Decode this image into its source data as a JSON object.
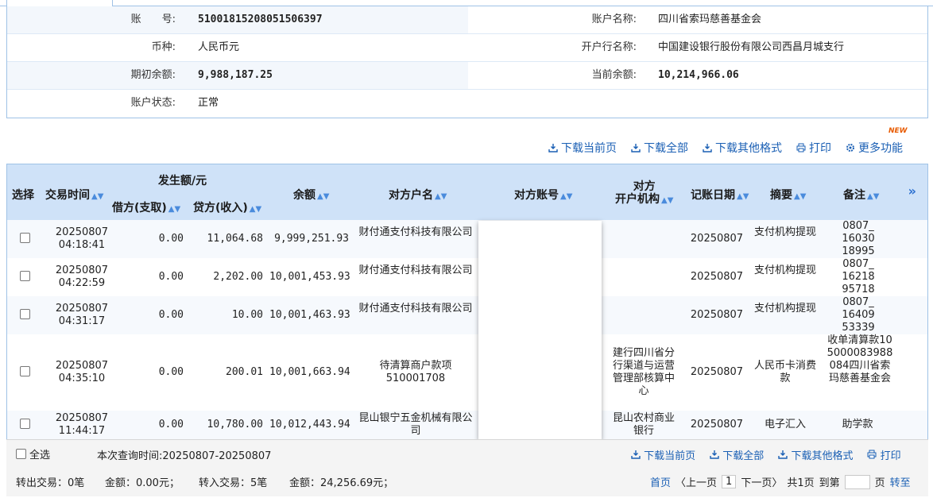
{
  "account": {
    "no_label": "账　　号:",
    "no_value": "51001815208051506397",
    "name_label": "账户名称:",
    "name_value": "四川省索玛慈善基金会",
    "currency_label": "币种:",
    "currency_value": "人民币元",
    "bank_label": "开户行名称:",
    "bank_value": "中国建设银行股份有限公司西昌月城支行",
    "opening_label": "期初余额:",
    "opening_value": "9,988,187.25",
    "current_label": "当前余额:",
    "current_value": "10,214,966.06",
    "status_label": "账户状态:",
    "status_value": "正常"
  },
  "toolbar": {
    "new_badge": "NEW",
    "items": [
      "下载当前页",
      "下载全部",
      "下载其他格式",
      "打印",
      "更多功能"
    ]
  },
  "table": {
    "headers": {
      "select": "选择",
      "time": "交易时间",
      "amount_group": "发生额/元",
      "debit": "借方(支取)",
      "credit": "贷方(收入)",
      "balance": "余额",
      "counter_name": "对方户名",
      "counter_acct": "对方账号",
      "counter_bank_1": "对方",
      "counter_bank_2": "开户机构",
      "book_date": "记账日期",
      "summary": "摘要",
      "remark": "备注",
      "expand": "»"
    },
    "rows": [
      {
        "date": "20250807",
        "time": "04:18:41",
        "debit": "0.00",
        "credit": "11,064.68",
        "balance": "9,999,251.93",
        "name": "财付通支付科技有限公司",
        "bank": "",
        "book": "20250807",
        "summary": "支付机构提现",
        "remark": "0807_1603018995"
      },
      {
        "date": "20250807",
        "time": "04:22:59",
        "debit": "0.00",
        "credit": "2,202.00",
        "balance": "10,001,453.93",
        "name": "财付通支付科技有限公司",
        "bank": "",
        "book": "20250807",
        "summary": "支付机构提现",
        "remark": "0807_1621895718"
      },
      {
        "date": "20250807",
        "time": "04:31:17",
        "debit": "0.00",
        "credit": "10.00",
        "balance": "10,001,463.93",
        "name": "财付通支付科技有限公司",
        "bank": "",
        "book": "20250807",
        "summary": "支付机构提现",
        "remark": "0807_1640953339"
      },
      {
        "date": "20250807",
        "time": "04:35:10",
        "debit": "0.00",
        "credit": "200.01",
        "balance": "10,001,663.94",
        "name": "待清算商户款项510001708",
        "bank": "建行四川省分行渠道与运营管理部核算中心",
        "book": "20250807",
        "summary": "人民币卡消费款",
        "remark": "收单清算款105000083988084四川省索玛慈善基金会"
      },
      {
        "date": "20250807",
        "time": "11:44:17",
        "debit": "0.00",
        "credit": "10,780.00",
        "balance": "10,012,443.94",
        "name": "昆山银宁五金机械有限公司",
        "bank": "昆山农村商业银行",
        "book": "20250807",
        "summary": "电子汇入",
        "remark": "助学款"
      }
    ]
  },
  "footer": {
    "select_all": "全选",
    "query_time": "本次查询时间:20250807-20250807",
    "actions": [
      "下载当前页",
      "下载全部",
      "下载其他格式",
      "打印"
    ],
    "out_label": "转出交易：0笔",
    "out_amount": "金额：0.00元；",
    "in_label": "转入交易：5笔",
    "in_amount": "金额：24,256.69元；",
    "first": "首页",
    "prev": "〈上一页",
    "page": "1",
    "next": "下一页〉",
    "total": "共1页",
    "goto_prefix": "到第",
    "goto_suffix": "页",
    "go": "转至"
  },
  "colors": {
    "accent": "#1a5fb4",
    "header_bg": "#cfe2f8",
    "border": "#9fc2e6"
  }
}
